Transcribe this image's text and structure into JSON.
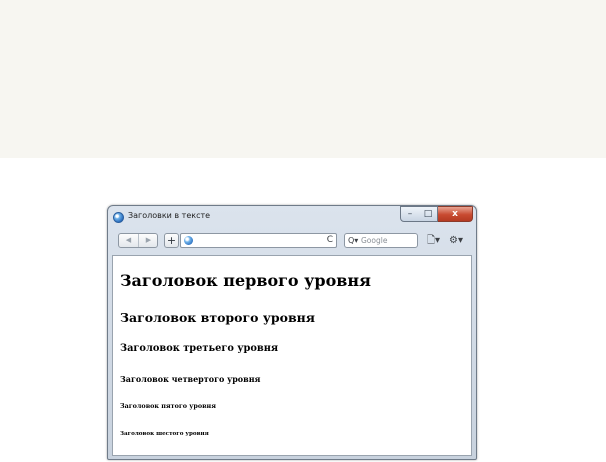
{
  "window": {
    "title": "Заголовки в тексте",
    "controls": {
      "minimize_glyph": "–",
      "maximize_glyph": "□",
      "close_glyph": "x"
    }
  },
  "toolbar": {
    "back_glyph": "◀",
    "forward_glyph": "▶",
    "new_tab_glyph": "+",
    "reload_glyph": "C",
    "search_icon_glyph": "Q▾",
    "search_placeholder": "Google",
    "page_menu_glyph": "🗋▾",
    "tools_menu_glyph": "⚙▾"
  },
  "icons": [
    "browser-icon",
    "back-icon",
    "forward-icon",
    "plus-icon",
    "globe-icon",
    "reload-icon",
    "search-icon",
    "page-menu-icon",
    "gear-icon"
  ],
  "colors": {
    "page_band": "#f7f6f1",
    "close_button": "#c84a31",
    "window_chrome": "#c8d2de"
  },
  "content": {
    "headings": [
      "Заголовок первого уровня",
      "Заголовок второго уровня",
      "Заголовок третьего уровня",
      "Заголовок четвертого уровня",
      "Заголовок пятого уровня",
      "Заголовок шестого уровня"
    ]
  }
}
